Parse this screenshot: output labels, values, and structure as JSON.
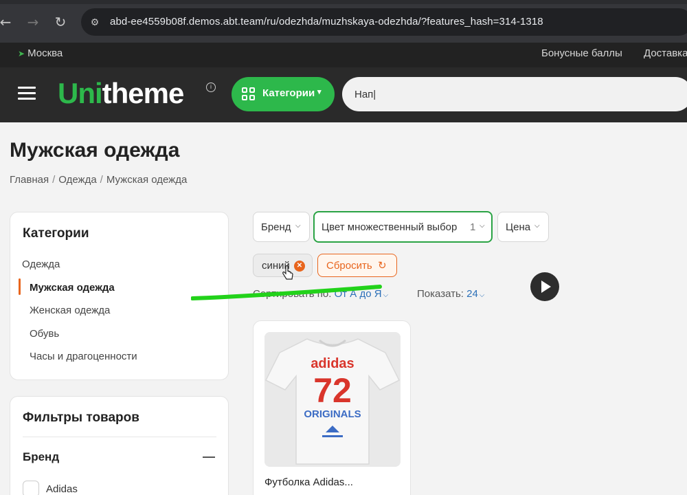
{
  "browser": {
    "url": "abd-ee4559b08f.demos.abt.team/ru/odezhda/muzhskaya-odezhda/?features_hash=314-1318"
  },
  "top_strip": {
    "city": "Москва",
    "links": [
      "Бонусные баллы",
      "Доставка"
    ]
  },
  "header": {
    "logo_part1": "Uni",
    "logo_part2": "theme",
    "categories_label": "Категории",
    "search_value": "Нап|"
  },
  "page": {
    "title": "Мужская одежда",
    "breadcrumb": [
      "Главная",
      "Одежда",
      "Мужская одежда"
    ]
  },
  "sidebar": {
    "categories_title": "Категории",
    "items": [
      {
        "label": "Одежда",
        "active": false
      },
      {
        "label": "Мужская одежда",
        "active": true
      },
      {
        "label": "Женская одежда",
        "active": false
      },
      {
        "label": "Обувь",
        "active": false
      },
      {
        "label": "Часы и драгоценности",
        "active": false
      }
    ],
    "filters_title": "Фильтры товаров",
    "brand_title": "Бренд",
    "brand_options": [
      "Adidas"
    ]
  },
  "filters": {
    "chips": [
      {
        "label": "Бренд"
      },
      {
        "label": "Цвет множественный выбор",
        "count": "1"
      },
      {
        "label": "Цена"
      }
    ],
    "applied_tag": "синий",
    "reset_label": "Сбросить"
  },
  "sort": {
    "label": "Сортировать по:",
    "value": "От А до Я",
    "show_label": "Показать:",
    "show_value": "24"
  },
  "product": {
    "name": "Футболка Adidas...",
    "image_brand": "adidas",
    "image_number": "72",
    "image_line": "ORIGINALS"
  },
  "colors": {
    "accent_green": "#2db84b",
    "accent_orange": "#e8651d",
    "link_blue": "#2c70b8",
    "header_bg": "#2a2a2a"
  }
}
